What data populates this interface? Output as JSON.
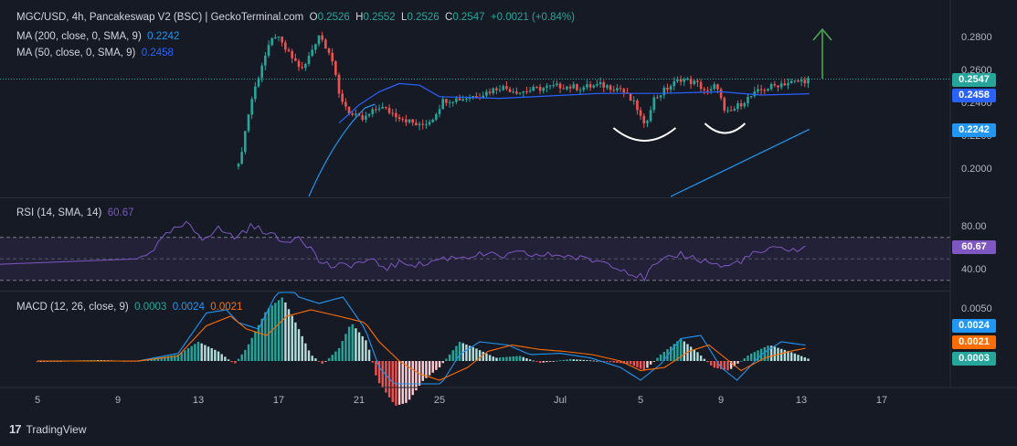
{
  "header": {
    "title": "MGC/USD, 4h, Pancakeswap V2 (BSC) | GeckoTerminal.com",
    "o_label": "O",
    "o_value": "0.2526",
    "h_label": "H",
    "h_value": "0.2552",
    "l_label": "L",
    "l_value": "0.2526",
    "c_label": "C",
    "c_value": "0.2547",
    "change": "+0.0021 (+0.84%)",
    "ma200_label": "MA (200, close, 0, SMA, 9)",
    "ma200_value": "0.2242",
    "ma50_label": "MA (50, close, 0, SMA, 9)",
    "ma50_value": "0.2458"
  },
  "rsi": {
    "label": "RSI (14, SMA, 14)",
    "value": "60.67",
    "ticks": [
      "80.00",
      "40.00"
    ],
    "badge": "60.67"
  },
  "macd": {
    "label": "MACD (12, 26, close, 9)",
    "hist_value": "0.0003",
    "macd_value": "0.0024",
    "signal_value": "0.0021",
    "top_tick": "0.0050",
    "badges": [
      "0.0024",
      "0.0021",
      "0.0003"
    ]
  },
  "price_axis": {
    "ticks": [
      "0.2800",
      "0.2600",
      "0.2400",
      "0.2200",
      "0.2000"
    ],
    "badges": [
      "0.2547",
      "0.2458",
      "0.2242"
    ]
  },
  "x_axis": {
    "ticks": [
      "5",
      "9",
      "13",
      "17",
      "21",
      "25",
      "Jul",
      "5",
      "9",
      "13",
      "17"
    ]
  },
  "footer": {
    "brand": "TradingView",
    "logo_text": "17"
  },
  "colors": {
    "bg": "#161a25",
    "up": "#26a69a",
    "down": "#ef5350",
    "ma50": "#2962ff",
    "ma200": "#2196f3",
    "rsi": "#7e57c2",
    "macd": "#2196f3",
    "signal": "#ff6d00",
    "arrow": "#4caf50",
    "grid": "#2a2e39"
  },
  "chart_data": [
    {
      "type": "candlestick",
      "title": "MGC/USD, 4h",
      "ylim": [
        0.19,
        0.29
      ],
      "x": [
        "5",
        "9",
        "13",
        "17",
        "21",
        "25",
        "Jul",
        "5",
        "9",
        "13",
        "17"
      ],
      "close_path": [
        [
          15.0,
          0.2015
        ],
        [
          15.6,
          0.24
        ],
        [
          16.2,
          0.265
        ],
        [
          16.8,
          0.282
        ],
        [
          17.5,
          0.27
        ],
        [
          18.2,
          0.26
        ],
        [
          19.0,
          0.282
        ],
        [
          19.6,
          0.27
        ],
        [
          20.0,
          0.245
        ],
        [
          20.6,
          0.233
        ],
        [
          21.2,
          0.23
        ],
        [
          22.0,
          0.238
        ],
        [
          23.0,
          0.232
        ],
        [
          24.0,
          0.226
        ],
        [
          24.6,
          0.23
        ],
        [
          25.2,
          0.242
        ],
        [
          26.2,
          0.243
        ],
        [
          27.2,
          0.246
        ],
        [
          28.0,
          0.25
        ],
        [
          29.0,
          0.247
        ],
        [
          30.0,
          0.249
        ],
        [
          31.0,
          0.2505
        ],
        [
          32.0,
          0.2495
        ],
        [
          33.0,
          0.251
        ],
        [
          34.0,
          0.249
        ],
        [
          34.8,
          0.238
        ],
        [
          35.2,
          0.225
        ],
        [
          35.6,
          0.242
        ],
        [
          36.2,
          0.248
        ],
        [
          37.0,
          0.255
        ],
        [
          37.8,
          0.252
        ],
        [
          38.4,
          0.246
        ],
        [
          38.8,
          0.252
        ],
        [
          39.2,
          0.233
        ],
        [
          39.6,
          0.236
        ],
        [
          40.2,
          0.242
        ],
        [
          41.0,
          0.248
        ],
        [
          42.0,
          0.252
        ],
        [
          42.8,
          0.253
        ],
        [
          43.4,
          0.2547
        ]
      ],
      "ma50_path": [
        [
          20.0,
          0.228
        ],
        [
          21.0,
          0.239
        ],
        [
          22.0,
          0.247
        ],
        [
          23.0,
          0.252
        ],
        [
          24.0,
          0.251
        ],
        [
          25.0,
          0.244
        ],
        [
          28.0,
          0.243
        ],
        [
          33.0,
          0.246
        ],
        [
          36.0,
          0.246
        ],
        [
          39.0,
          0.247
        ],
        [
          41.0,
          0.245
        ],
        [
          43.4,
          0.2458
        ]
      ],
      "ma200_path": [
        [
          18.5,
          0.191
        ],
        [
          19.5,
          0.205
        ],
        [
          20.3,
          0.215
        ],
        [
          21.3,
          0.223
        ],
        [
          22.5,
          0.228
        ],
        [
          36.5,
          0.19
        ],
        [
          43.4,
          0.2242
        ]
      ],
      "annotations": [
        "arrow-up",
        "arc-low-1",
        "arc-low-2"
      ]
    },
    {
      "type": "line",
      "title": "RSI (14, SMA, 14)",
      "ylim": [
        20,
        100
      ],
      "bands": [
        30,
        70
      ],
      "path": [
        [
          10.0,
          50
        ],
        [
          10.8,
          60
        ],
        [
          11.6,
          75
        ],
        [
          12.4,
          82
        ],
        [
          13.2,
          70
        ],
        [
          14.0,
          78
        ],
        [
          14.8,
          70
        ],
        [
          15.6,
          80
        ],
        [
          16.4,
          76
        ],
        [
          17.2,
          65
        ],
        [
          18.0,
          72
        ],
        [
          18.6,
          60
        ],
        [
          19.0,
          48
        ],
        [
          19.8,
          42
        ],
        [
          20.6,
          45
        ],
        [
          21.5,
          48
        ],
        [
          22.4,
          42
        ],
        [
          23.3,
          47
        ],
        [
          24.1,
          44
        ],
        [
          25.0,
          50
        ],
        [
          26.0,
          52
        ],
        [
          27.2,
          54
        ],
        [
          28.0,
          52
        ],
        [
          29.0,
          55
        ],
        [
          30.0,
          53
        ],
        [
          31.0,
          54
        ],
        [
          32.0,
          50
        ],
        [
          33.0,
          48
        ],
        [
          33.8,
          44
        ],
        [
          34.6,
          36
        ],
        [
          35.2,
          32
        ],
        [
          35.6,
          42
        ],
        [
          36.2,
          48
        ],
        [
          37.0,
          55
        ],
        [
          37.8,
          50
        ],
        [
          38.6,
          46
        ],
        [
          39.2,
          42
        ],
        [
          39.8,
          47
        ],
        [
          40.6,
          54
        ],
        [
          41.4,
          58
        ],
        [
          42.2,
          60
        ],
        [
          42.8,
          58
        ],
        [
          43.4,
          60.67
        ]
      ]
    },
    {
      "type": "bar+line",
      "title": "MACD (12, 26, close, 9)",
      "ylim": [
        -0.012,
        0.012
      ],
      "histogram_path": [
        [
          10.0,
          0.0
        ],
        [
          12.0,
          0.001
        ],
        [
          13.0,
          0.003
        ],
        [
          14.0,
          0.0015
        ],
        [
          14.8,
          -0.0005
        ],
        [
          15.4,
          0.002
        ],
        [
          16.4,
          0.008
        ],
        [
          17.2,
          0.01
        ],
        [
          18.0,
          0.005
        ],
        [
          18.6,
          0.001
        ],
        [
          19.2,
          -0.0005
        ],
        [
          20.0,
          0.002
        ],
        [
          20.6,
          0.006
        ],
        [
          21.4,
          0.003
        ],
        [
          21.9,
          -0.003
        ],
        [
          22.8,
          -0.007
        ],
        [
          23.4,
          -0.0065
        ],
        [
          24.2,
          -0.003
        ],
        [
          25.0,
          -0.001
        ],
        [
          26.0,
          0.003
        ],
        [
          26.8,
          0.002
        ],
        [
          27.8,
          0.0005
        ],
        [
          29.0,
          0.0008
        ],
        [
          30.0,
          -0.0003
        ],
        [
          31.5,
          0.0003
        ],
        [
          33.0,
          0.0
        ],
        [
          34.5,
          -0.0005
        ],
        [
          35.2,
          -0.0015
        ],
        [
          36.0,
          0.001
        ],
        [
          37.0,
          0.0035
        ],
        [
          37.8,
          0.0015
        ],
        [
          38.6,
          -0.001
        ],
        [
          39.4,
          -0.0015
        ],
        [
          40.4,
          0.001
        ],
        [
          41.4,
          0.0025
        ],
        [
          42.4,
          0.0015
        ],
        [
          43.4,
          0.0003
        ]
      ],
      "macd_path": [
        [
          10.0,
          0.0
        ],
        [
          12.0,
          0.0012
        ],
        [
          13.4,
          0.0075
        ],
        [
          14.4,
          0.008
        ],
        [
          15.0,
          0.006
        ],
        [
          16.0,
          0.005
        ],
        [
          16.8,
          0.01
        ],
        [
          17.4,
          0.012
        ],
        [
          18.0,
          0.01
        ],
        [
          19.0,
          0.009
        ],
        [
          20.2,
          0.01
        ],
        [
          21.3,
          0.005
        ],
        [
          22.0,
          -0.001
        ],
        [
          23.0,
          -0.0045
        ],
        [
          24.0,
          -0.005
        ],
        [
          25.0,
          -0.004
        ],
        [
          26.0,
          0.001
        ],
        [
          27.0,
          0.003
        ],
        [
          28.4,
          0.0025
        ],
        [
          29.5,
          0.001
        ],
        [
          31.0,
          0.0012
        ],
        [
          32.5,
          0.0005
        ],
        [
          34.0,
          -0.001
        ],
        [
          35.0,
          -0.003
        ],
        [
          36.0,
          -0.0005
        ],
        [
          37.0,
          0.0035
        ],
        [
          38.0,
          0.004
        ],
        [
          39.0,
          -0.001
        ],
        [
          39.8,
          -0.003
        ],
        [
          41.0,
          0.001
        ],
        [
          42.0,
          0.003
        ],
        [
          43.4,
          0.0024
        ]
      ],
      "signal_path": [
        [
          10.0,
          0.0
        ],
        [
          12.0,
          0.0008
        ],
        [
          13.4,
          0.0055
        ],
        [
          14.6,
          0.007
        ],
        [
          15.4,
          0.005
        ],
        [
          16.4,
          0.004
        ],
        [
          17.4,
          0.007
        ],
        [
          18.6,
          0.008
        ],
        [
          20.0,
          0.007
        ],
        [
          21.3,
          0.006
        ],
        [
          22.0,
          0.003
        ],
        [
          23.0,
          0.0
        ],
        [
          24.0,
          -0.002
        ],
        [
          25.0,
          -0.003
        ],
        [
          26.4,
          -0.001
        ],
        [
          27.4,
          0.0015
        ],
        [
          28.6,
          0.0025
        ],
        [
          30.0,
          0.0018
        ],
        [
          31.2,
          0.0015
        ],
        [
          32.6,
          0.001
        ],
        [
          34.0,
          0.0
        ],
        [
          35.0,
          -0.0015
        ],
        [
          36.2,
          -0.001
        ],
        [
          37.4,
          0.0015
        ],
        [
          38.4,
          0.0025
        ],
        [
          39.2,
          0.0005
        ],
        [
          40.0,
          -0.0015
        ],
        [
          41.2,
          0.0005
        ],
        [
          42.4,
          0.0015
        ],
        [
          43.4,
          0.0021
        ]
      ]
    }
  ]
}
